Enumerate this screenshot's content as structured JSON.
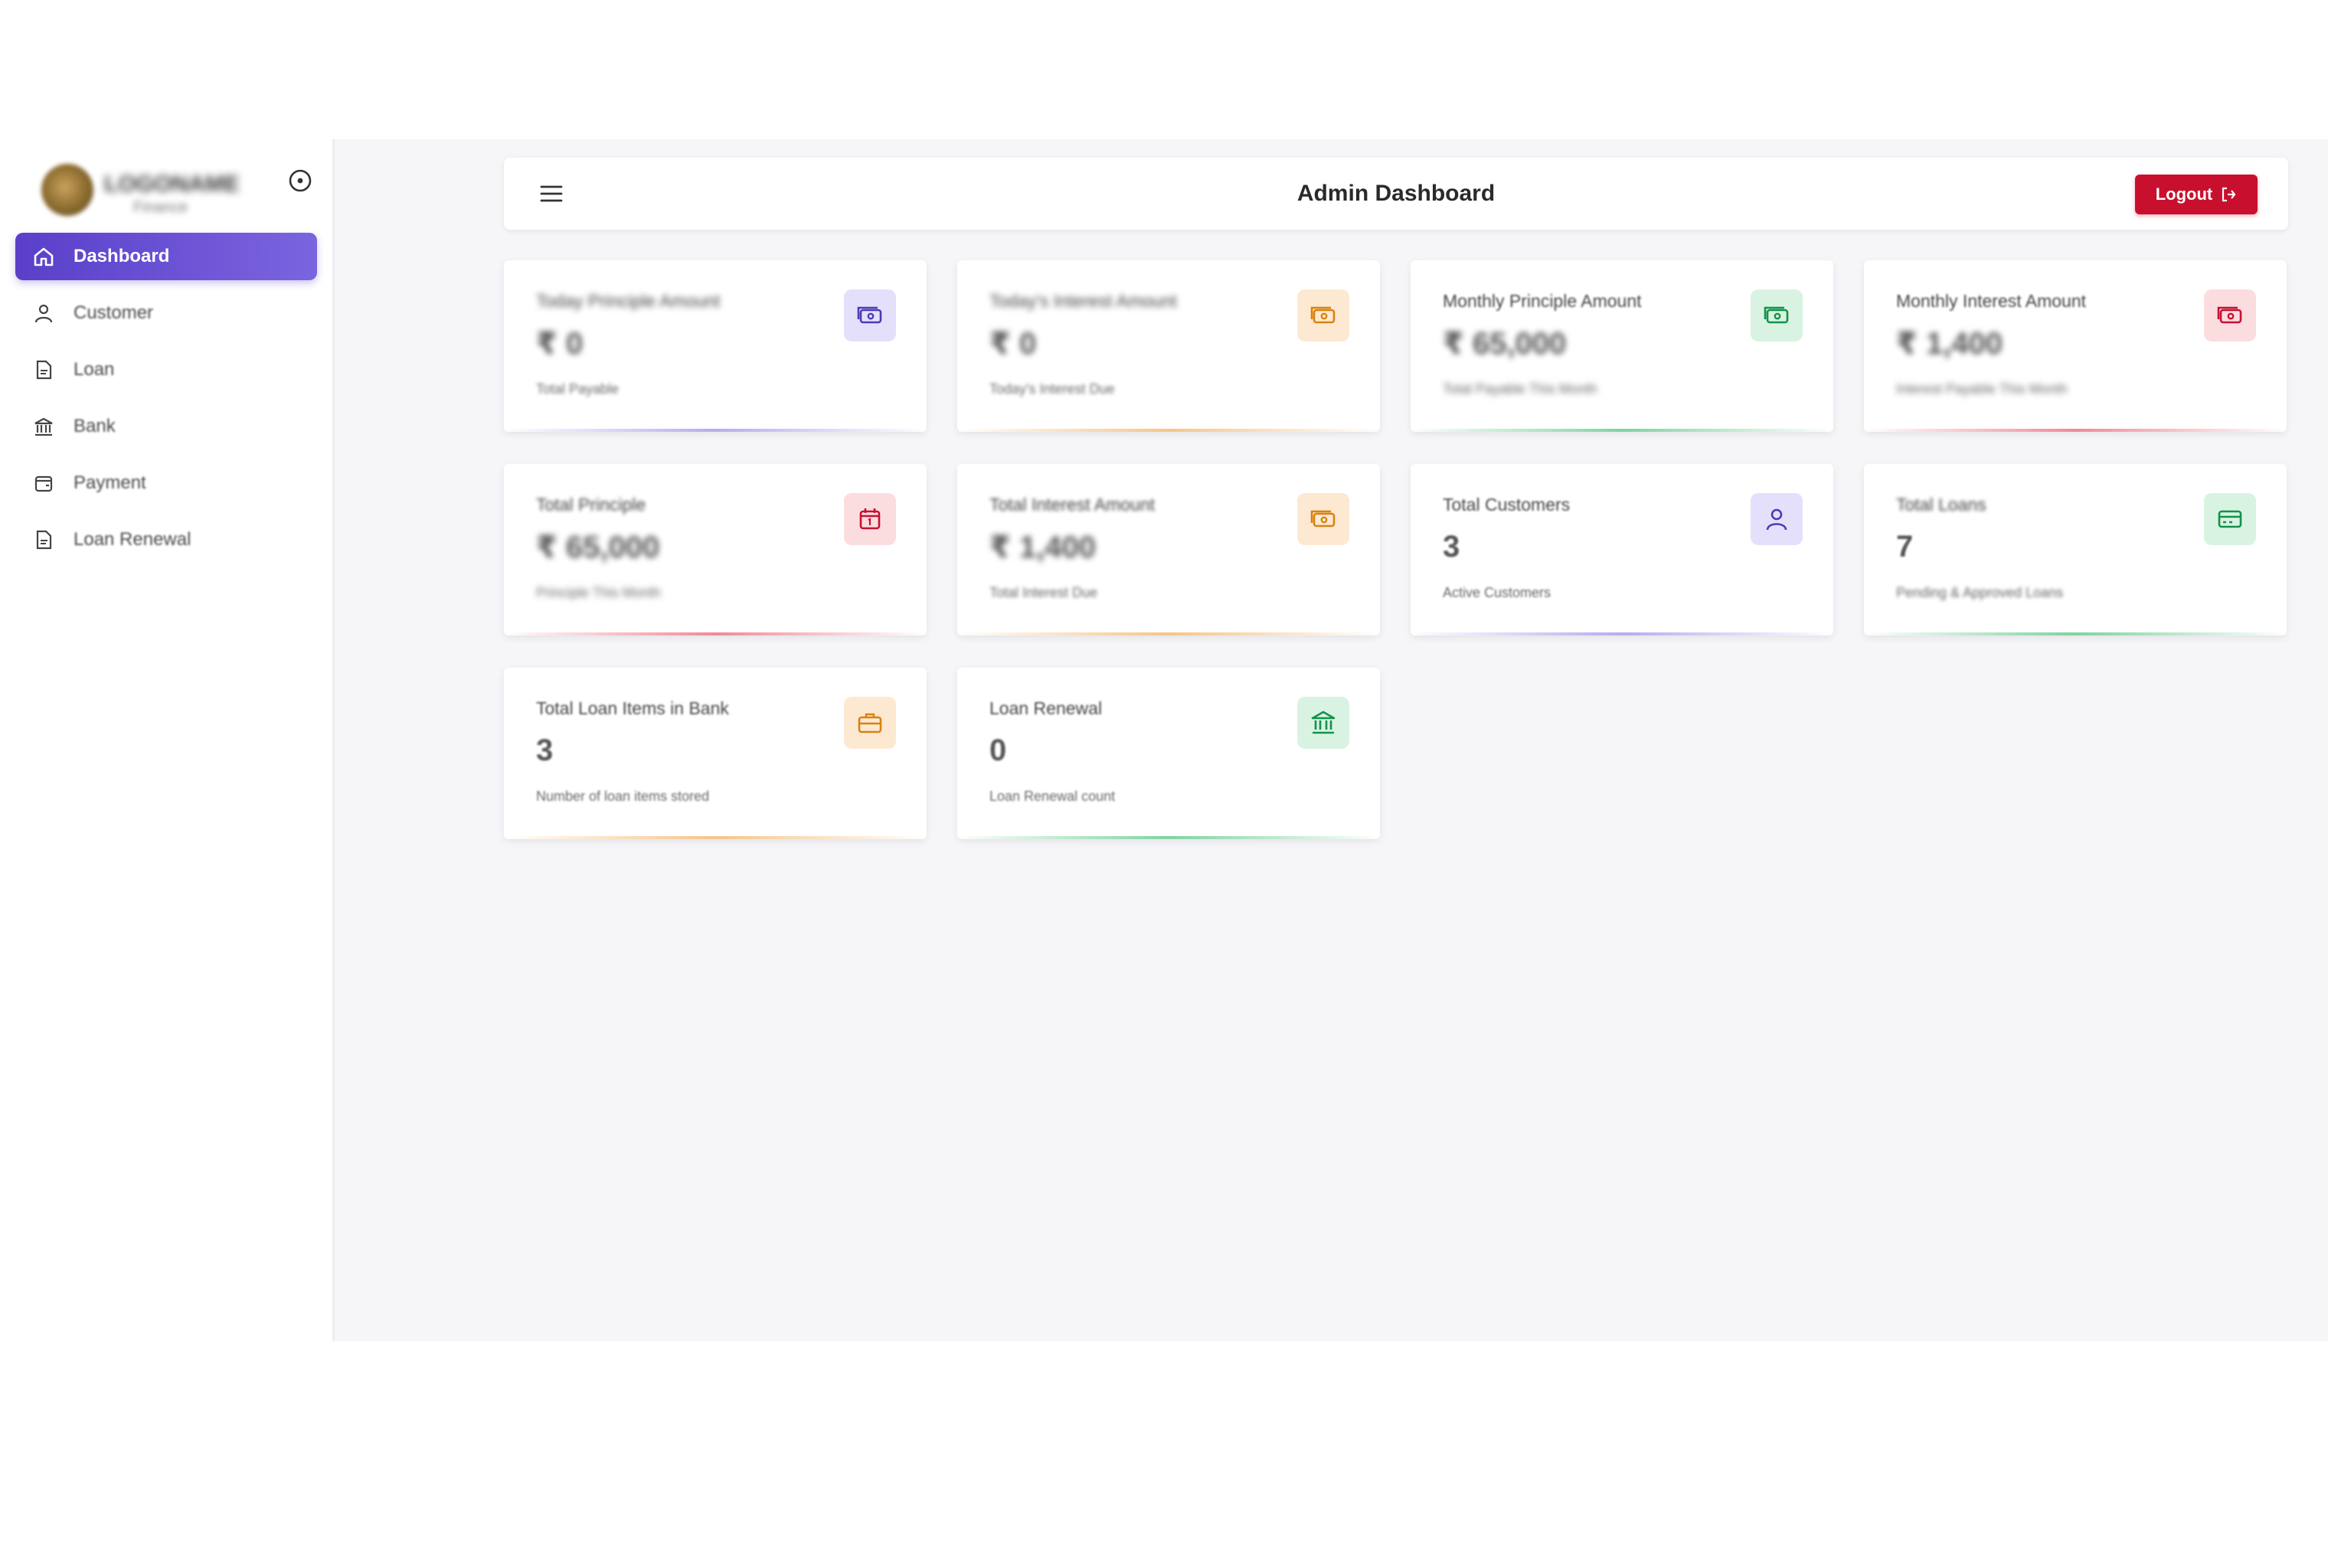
{
  "sidebar": {
    "brand_name": "LOGONAME",
    "brand_sub": "Finance",
    "items": [
      {
        "label": "Dashboard",
        "icon": "home-icon",
        "active": true
      },
      {
        "label": "Customer",
        "icon": "user-icon"
      },
      {
        "label": "Loan",
        "icon": "document-icon"
      },
      {
        "label": "Bank",
        "icon": "bank-icon"
      },
      {
        "label": "Payment",
        "icon": "wallet-icon"
      },
      {
        "label": "Loan Renewal",
        "icon": "document-icon"
      }
    ]
  },
  "header": {
    "title": "Admin Dashboard",
    "logout_label": "Logout"
  },
  "cards": [
    {
      "label": "Today Principle Amount",
      "value": "₹ 0",
      "sub": "Total Payable",
      "icon": "money-icon",
      "color": "purple"
    },
    {
      "label": "Today's Interest Amount",
      "value": "₹ 0",
      "sub": "Today's Interest Due",
      "icon": "money-icon",
      "color": "orange"
    },
    {
      "label": "Monthly Principle Amount",
      "value": "₹ 65,000",
      "sub": "Total Payable This Month",
      "icon": "money-icon",
      "color": "green"
    },
    {
      "label": "Monthly Interest Amount",
      "value": "₹ 1,400",
      "sub": "Interest Payable This Month",
      "icon": "money-icon",
      "color": "red"
    },
    {
      "label": "Total Principle",
      "value": "₹ 65,000",
      "sub": "Principle This Month",
      "icon": "calendar-icon",
      "color": "red"
    },
    {
      "label": "Total Interest Amount",
      "value": "₹ 1,400",
      "sub": "Total Interest Due",
      "icon": "money-icon",
      "color": "orange"
    },
    {
      "label": "Total Customers",
      "value": "3",
      "sub": "Active Customers",
      "icon": "user-icon",
      "color": "purple"
    },
    {
      "label": "Total Loans",
      "value": "7",
      "sub": "Pending & Approved Loans",
      "icon": "credit-card-icon",
      "color": "green"
    },
    {
      "label": "Total Loan Items in Bank",
      "value": "3",
      "sub": "Number of loan items stored",
      "icon": "briefcase-icon",
      "color": "orange"
    },
    {
      "label": "Loan Renewal",
      "value": "0",
      "sub": "Loan Renewal count",
      "icon": "bank-icon",
      "color": "green"
    }
  ],
  "colors": {
    "accent": "#5a3fc9",
    "logout": "#c8102e",
    "purple": "#4b3bb5",
    "orange": "#d9820f",
    "green": "#12924a",
    "red": "#c8102e"
  }
}
